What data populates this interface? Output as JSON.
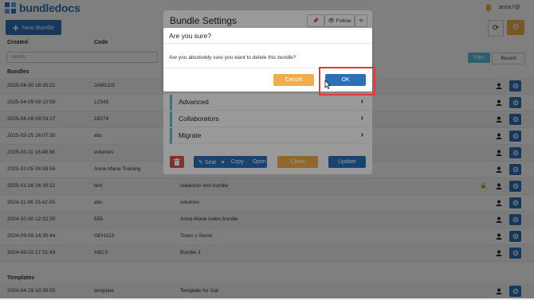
{
  "header": {
    "logo_text": "bundledocs",
    "user_name": "anna7@",
    "new_bundle_label": "New Bundle"
  },
  "list": {
    "columns": {
      "created": "Created",
      "code": "Code"
    },
    "search_placeholder": "search",
    "filter_label": "Filter",
    "recent_label": "Recent",
    "bundles_section": "Bundles",
    "templates_section": "Templates",
    "bundles": [
      {
        "created": "2025-04-30 16:35:21",
        "code": "JAM12/3",
        "name": ""
      },
      {
        "created": "2025-04-09 09:10:58",
        "code": "12345",
        "name": ""
      },
      {
        "created": "2025-04-08 09:03:17",
        "code": "18274",
        "name": ""
      },
      {
        "created": "2025-03-25 16:07:35",
        "code": "abc",
        "name": ""
      },
      {
        "created": "2025-03-11 16:48:36",
        "code": "volumes",
        "name": ""
      },
      {
        "created": "2025-02-05 08:58:56",
        "code": "Anne-Marie Training",
        "name": ""
      },
      {
        "created": "2025-01-16 16:30:12",
        "code": "test",
        "name": "redaction test bundle"
      },
      {
        "created": "2024-11-06 15:42:05",
        "code": "abc",
        "name": "volumes"
      },
      {
        "created": "2024-10-30 12:32:20",
        "code": "555",
        "name": "Anne-Marie index bundle"
      },
      {
        "created": "2024-09-09 14:35:44",
        "code": "GEH123",
        "name": "Trees v Storm"
      },
      {
        "created": "2024-09-02 17:31:43",
        "code": "ABC3",
        "name": "Bundle 3"
      }
    ],
    "templates": [
      {
        "created": "2024-04-29 10:35:55",
        "code": "template",
        "name": "Template for Gal"
      }
    ]
  },
  "modal": {
    "title": "Bundle Settings",
    "pin_label": "",
    "follow_label": "Follow",
    "sections": [
      "Advanced",
      "Collaborators",
      "Migrate"
    ],
    "seal_label": "Seal",
    "copy_label": "Copy",
    "open_label": "Open",
    "close_label": "Close",
    "update_label": "Update"
  },
  "confirm": {
    "title": "Are you sure?",
    "message": "Are you absolutely sure you want to delete this bundle?",
    "cancel_label": "Cancel",
    "ok_label": "OK"
  },
  "colors": {
    "primary": "#2a70b8",
    "warning": "#f0ad4e",
    "info": "#5bc0de",
    "danger": "#d9534f",
    "highlight": "#e53935"
  }
}
